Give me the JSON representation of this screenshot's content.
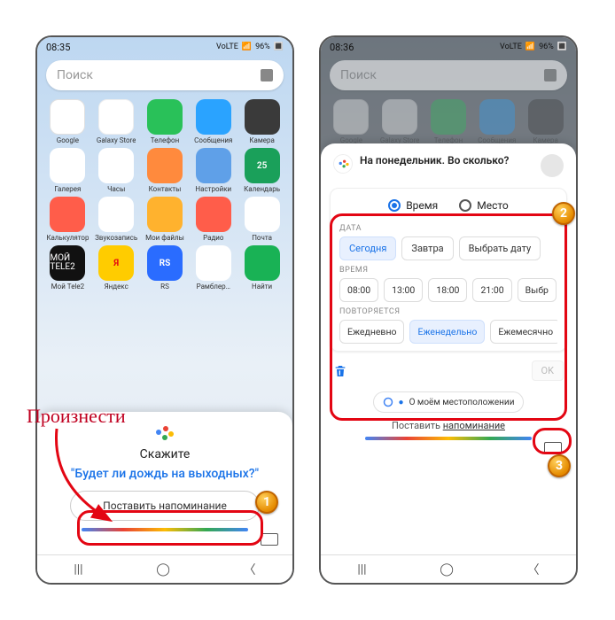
{
  "status": {
    "time_left": "08:35",
    "time_right": "08:36",
    "battery": "96%",
    "net": "VoLTE"
  },
  "search": {
    "placeholder": "Поиск"
  },
  "apps": {
    "row1": [
      {
        "l": "Google",
        "c": "ic-google"
      },
      {
        "l": "Galaxy Store",
        "c": "ic-store"
      },
      {
        "l": "Телефон",
        "c": "ic-phone"
      },
      {
        "l": "Сообщения",
        "c": "ic-msg"
      },
      {
        "l": "Камера",
        "c": "ic-cam"
      }
    ],
    "row2": [
      {
        "l": "Галерея",
        "c": "ic-gal"
      },
      {
        "l": "Часы",
        "c": "ic-clock"
      },
      {
        "l": "Контакты",
        "c": "ic-cont"
      },
      {
        "l": "Настройки",
        "c": "ic-set"
      },
      {
        "l": "Календарь",
        "c": "ic-cal",
        "t": "25"
      }
    ],
    "row3": [
      {
        "l": "Калькулятор",
        "c": "ic-calc"
      },
      {
        "l": "Звукозапись",
        "c": "ic-rec"
      },
      {
        "l": "Мои файлы",
        "c": "ic-files"
      },
      {
        "l": "Радио",
        "c": "ic-radio"
      },
      {
        "l": "Почта",
        "c": "ic-mail"
      }
    ],
    "row4": [
      {
        "l": "Мой Tele2",
        "c": "ic-tele",
        "t": "МОЙ TELE2"
      },
      {
        "l": "Яндекс",
        "c": "ic-yx",
        "t": "Я"
      },
      {
        "l": "RS",
        "c": "ic-rs",
        "t": "RS"
      },
      {
        "l": "Рамблер…",
        "c": "ic-ram"
      },
      {
        "l": "Найти",
        "c": "ic-find"
      }
    ]
  },
  "assist_left": {
    "say": "Скажите",
    "example": "\"Будет ли дождь на выходных?\"",
    "btn": "Поставить напоминание"
  },
  "assist_right": {
    "header": "На понедельник. Во сколько?",
    "tab_time": "Время",
    "tab_place": "Место",
    "sec_date": "ДАТА",
    "date_opts": [
      "Сегодня",
      "Завтра",
      "Выбрать дату"
    ],
    "sec_time": "ВРЕМЯ",
    "time_opts": [
      "08:00",
      "13:00",
      "18:00",
      "21:00",
      "Выбр"
    ],
    "sec_rep": "ПОВТОРЯЕТСЯ",
    "rep_opts": [
      "Ежедневно",
      "Еженедельно",
      "Ежемесячно"
    ],
    "ok": "OK",
    "sug": "О моём местоположении",
    "rem_prefix": "Поставить ",
    "rem_link": "напоминание"
  },
  "annot": {
    "say": "Произнести",
    "b1": "1",
    "b2": "2",
    "b3": "3"
  }
}
